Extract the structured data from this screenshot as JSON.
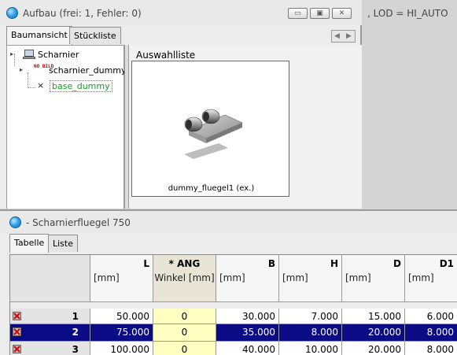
{
  "top_window": {
    "title": "Aufbau (frei: 1, Fehler: 0)",
    "buttons": {
      "minimize": "▭",
      "maximize": "▣",
      "close": "✕"
    },
    "tabs": [
      "Baumansicht",
      "Stückliste"
    ],
    "active_tab": "Baumansicht",
    "tree": {
      "root": "Scharnier",
      "child": "scharnier_dummy",
      "child_icon_text": "NO BILD",
      "leaf": "base_dummy",
      "leaf_color": "#169c23"
    },
    "preview": {
      "label": "Auswahlliste",
      "caption": "dummy_fluegel1 (ex.)"
    }
  },
  "lod_text": ", LOD = HI_AUTO",
  "bottom_window": {
    "title": "- Scharnierfluegel 750",
    "tabs": [
      "Tabelle",
      "Liste"
    ],
    "active_tab": "Tabelle",
    "columns": [
      {
        "name": "L",
        "unit": "[mm]"
      },
      {
        "name": "* ANG",
        "unit": "Winkel [mm]"
      },
      {
        "name": "B",
        "unit": "[mm]"
      },
      {
        "name": "H",
        "unit": "[mm]"
      },
      {
        "name": "D",
        "unit": "[mm]"
      },
      {
        "name": "D1",
        "unit": "[mm]"
      }
    ],
    "rows": [
      {
        "num": "1",
        "values": [
          "50.000",
          "0",
          "30.000",
          "7.000",
          "15.000",
          "6.000"
        ]
      },
      {
        "num": "2",
        "values": [
          "75.000",
          "0",
          "35.000",
          "8.000",
          "20.000",
          "8.000"
        ],
        "selected": true
      },
      {
        "num": "3",
        "values": [
          "100.000",
          "0",
          "40.000",
          "10.000",
          "20.000",
          "8.000"
        ]
      }
    ],
    "selection_color": "#0b0b85",
    "angle_column_color": "#ffffc2"
  }
}
